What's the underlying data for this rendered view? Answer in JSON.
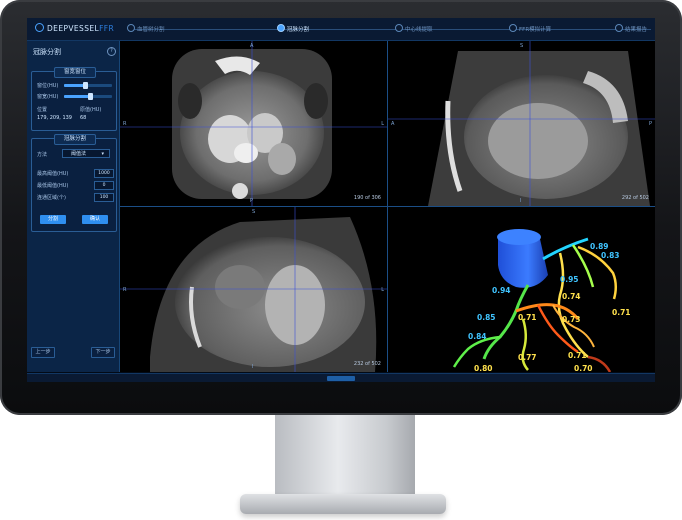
{
  "app": {
    "logo_main": "DEEPVESSEL",
    "logo_suffix": "FFR"
  },
  "steps": [
    {
      "label": "血管树分割"
    },
    {
      "label": "冠脉分割",
      "active": true
    },
    {
      "label": "中心线提取"
    },
    {
      "label": "FFR模拟计算"
    },
    {
      "label": "结果报告"
    }
  ],
  "sidebar": {
    "title": "冠脉分割",
    "help": "?",
    "window_panel": {
      "header": "窗宽窗位",
      "ww_label": "窗位(HU)",
      "ww_value": 0.45,
      "wl_label": "窗宽(HU)",
      "wl_value": 0.55,
      "position_label": "位置",
      "position_value": "179, 209, 139",
      "hu_label": "原值(HU)",
      "hu_value": "68"
    },
    "seg_panel": {
      "header": "冠脉分割",
      "method_label": "方法",
      "method_value": "阈值法",
      "param1_label": "最高阈值(HU)",
      "param1_value": "1000",
      "param2_label": "最低阈值(HU)",
      "param2_value": "0",
      "param3_label": "连通区域(个)",
      "param3_value": "100",
      "btn_seg": "分割",
      "btn_confirm": "确认"
    },
    "prev": "上一步",
    "next": "下一步"
  },
  "viewports": {
    "axial": {
      "top": "A",
      "left": "R",
      "right": "L",
      "bottom": "P",
      "counter": "190 of 306"
    },
    "sagittal": {
      "top": "S",
      "left": "A",
      "right": "P",
      "bottom": "I",
      "counter": "292 of 502"
    },
    "coronal": {
      "top": "S",
      "left": "R",
      "right": "L",
      "bottom": "I",
      "counter": "232 of 502"
    }
  },
  "ffr_labels": [
    {
      "text": "0.89",
      "color": "#40c4ff"
    },
    {
      "text": "0.83",
      "color": "#40c4ff"
    },
    {
      "text": "0.95",
      "color": "#40c4ff"
    },
    {
      "text": "0.94",
      "color": "#40c4ff"
    },
    {
      "text": "0.74",
      "color": "#ffe14d"
    },
    {
      "text": "0.71",
      "color": "#ffe14d"
    },
    {
      "text": "0.71",
      "color": "#ffe14d"
    },
    {
      "text": "0.73",
      "color": "#ffe14d"
    },
    {
      "text": "0.85",
      "color": "#40c4ff"
    },
    {
      "text": "0.84",
      "color": "#40c4ff"
    },
    {
      "text": "0.77",
      "color": "#ffe14d"
    },
    {
      "text": "0.71",
      "color": "#ffe14d"
    },
    {
      "text": "0.80",
      "color": "#ffe14d"
    },
    {
      "text": "0.70",
      "color": "#ffe14d"
    }
  ]
}
